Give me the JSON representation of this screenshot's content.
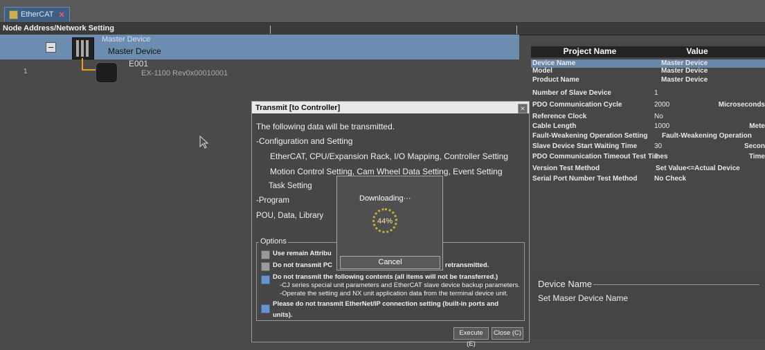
{
  "tab": {
    "label": "EtherCAT"
  },
  "node_panel": {
    "header": "Node Address/Network Setting",
    "master": {
      "top_label": "Master Device",
      "name": "Master Device"
    },
    "child": {
      "node_number": "1",
      "name": "E001",
      "revision": "EX-1100 Rev0x00010001"
    }
  },
  "properties": {
    "col_name": "Project Name",
    "col_value": "Value",
    "rows": [
      {
        "name": "Device Name",
        "value": "Master Device",
        "unit": ""
      },
      {
        "name": "Model",
        "value": "Master Device",
        "unit": ""
      },
      {
        "name": "Product Name",
        "value": "Master Device",
        "unit": ""
      },
      {
        "name": "Number of Slave Device",
        "value": "1",
        "unit": ""
      },
      {
        "name": "PDO Communication Cycle",
        "value": "2000",
        "unit": "Microseconds"
      },
      {
        "name": "Reference Clock",
        "value": "No",
        "unit": ""
      },
      {
        "name": "Cable Length",
        "value": "1000",
        "unit": "Mete"
      },
      {
        "name": "Fault-Weakening Operation Setting",
        "value": "Fault-Weakening Operation",
        "unit": ""
      },
      {
        "name": "Slave Device Start Waiting Time",
        "value": "30",
        "unit": "Secon"
      },
      {
        "name": "PDO Communication Timeout Test Times",
        "value": "2",
        "unit": "Time"
      },
      {
        "name": "Version Test Method",
        "value": "Set Value<=Actual Device",
        "unit": ""
      },
      {
        "name": "Serial Port Number Test Method",
        "value": "No Check",
        "unit": ""
      }
    ],
    "description_title": "Device Name",
    "description_text": "Set Maser Device Name"
  },
  "dialog": {
    "title": "Transmit [to Controller]",
    "intro": "The following data will be transmitted.",
    "config_heading": "-Configuration and Setting",
    "config_line1": "EtherCAT, CPU/Expansion Rack, I/O Mapping, Controller Setting",
    "config_line2": "Motion Control Setting, Cam Wheel Data Setting, Event Setting",
    "task_setting": "Task Setting",
    "program_heading": "-Program",
    "program_line": "POU, Data, Library",
    "options_label": "Options",
    "opt1": "Use remain Attribu",
    "opt2a": "Do not transmit PC",
    "opt2b": "e retransmitted.",
    "opt3": "Do not transmit the following contents (all items will not be transferred.)",
    "opt3_sub1": "-CJ series special unit parameters and EtherCAT slave device backup parameters.",
    "opt3_sub2": "-Operate the setting and NX unit application data from the terminal device unit.",
    "opt4a": "Please do not transmit EtherNet/IP connection setting (built-in ports and",
    "opt4b": "units).",
    "execute": "Execute (E)",
    "close": "Close (C)"
  },
  "progress": {
    "label": "Downloading···",
    "percent_text": "44%",
    "percent": 44,
    "cancel": "Cancel"
  }
}
